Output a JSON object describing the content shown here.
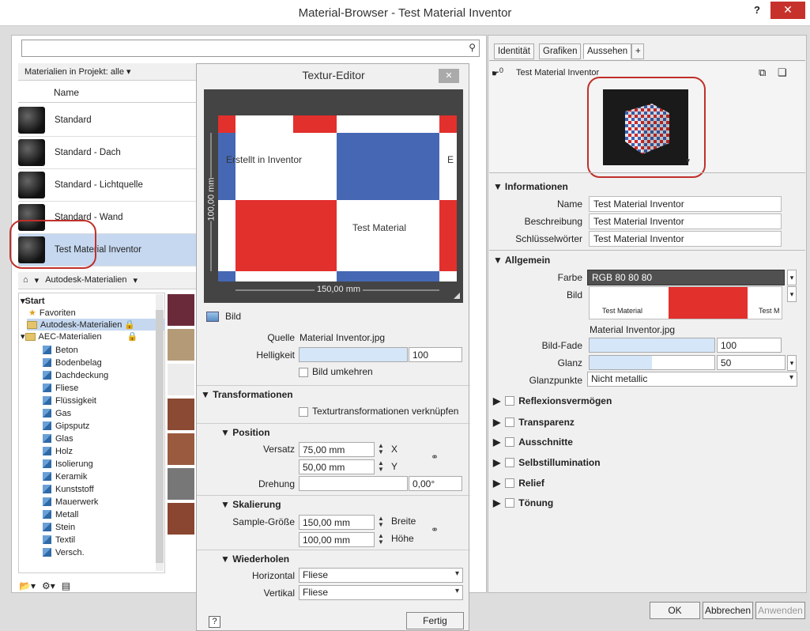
{
  "window": {
    "title": "Material-Browser - Test Material Inventor",
    "help": "?",
    "close": "✕"
  },
  "left": {
    "search_value": "",
    "filter_label": "Materialien in Projekt: alle",
    "column_name": "Name",
    "materials": [
      "Standard",
      "Standard - Dach",
      "Standard - Lichtquelle",
      "Standard - Wand",
      "Test Material Inventor"
    ],
    "library_crumb": "Autodesk-Materialien",
    "tree": {
      "start": "Start",
      "favorites": "Favoriten",
      "autodesk": "Autodesk-Materialien",
      "aec": "AEC-Materialien",
      "items": [
        "Beton",
        "Bodenbelag",
        "Dachdeckung",
        "Fliese",
        "Flüssigkeit",
        "Gas",
        "Gipsputz",
        "Glas",
        "Holz",
        "Isolierung",
        "Keramik",
        "Kunststoff",
        "Mauerwerk",
        "Metall",
        "Stein",
        "Textil",
        "Versch."
      ]
    }
  },
  "texture_editor": {
    "title": "Textur-Editor",
    "close": "✕",
    "preview": {
      "text1": "Erstellt in Inventor",
      "text2": "Test Material",
      "text3": "E",
      "height_dim": "100,00 mm",
      "width_dim": "150,00 mm"
    },
    "bild_header": "Bild",
    "quelle_label": "Quelle",
    "quelle_value": "Material Inventor.jpg",
    "helligkeit_label": "Helligkeit",
    "helligkeit_value": "100",
    "bild_umkehren": "Bild umkehren",
    "transform_header": "Transformationen",
    "transform_link": "Texturtransformationen verknüpfen",
    "position_header": "Position",
    "versatz_label": "Versatz",
    "versatz_x": "75,00 mm",
    "versatz_y": "50,00 mm",
    "x_label": "X",
    "y_label": "Y",
    "drehung_label": "Drehung",
    "drehung_value": "0,00°",
    "skalierung_header": "Skalierung",
    "sample_label": "Sample-Größe",
    "breite_value": "150,00 mm",
    "hoehe_value": "100,00 mm",
    "breite_label": "Breite",
    "hoehe_label": "Höhe",
    "wiederholen_header": "Wiederholen",
    "horizontal_label": "Horizontal",
    "horizontal_value": "Fliese",
    "vertikal_label": "Vertikal",
    "vertikal_value": "Fliese",
    "help": "?",
    "done": "Fertig"
  },
  "right": {
    "tabs": [
      "Identität",
      "Grafiken",
      "Aussehen",
      "+"
    ],
    "asset_count": "0",
    "asset_name": "Test Material Inventor",
    "info_header": "Informationen",
    "name_label": "Name",
    "name_value": "Test Material Inventor",
    "desc_label": "Beschreibung",
    "desc_value": "Test Material Inventor",
    "keys_label": "Schlüsselwörter",
    "keys_value": "Test Material Inventor",
    "general_header": "Allgemein",
    "farbe_label": "Farbe",
    "farbe_value": "RGB 80 80 80",
    "bild_label": "Bild",
    "bild_thumb_text1": "Test Material",
    "bild_thumb_text2": "Test M",
    "bild_file": "Material Inventor.jpg",
    "fade_label": "Bild-Fade",
    "fade_value": "100",
    "fade_level": 1.0,
    "glanz_label": "Glanz",
    "glanz_value": "50",
    "glanz_level": 0.5,
    "glanzpunkte_label": "Glanzpunkte",
    "glanzpunkte_value": "Nicht metallic",
    "groups": [
      "Reflexionsvermögen",
      "Transparenz",
      "Ausschnitte",
      "Selbstillumination",
      "Relief",
      "Tönung"
    ],
    "ok": "OK",
    "cancel": "Abbrechen",
    "apply": "Anwenden"
  },
  "colors": {
    "accent_red": "#e2302d",
    "tile_blue": "#4668b4",
    "highlight": "#c0302a"
  }
}
